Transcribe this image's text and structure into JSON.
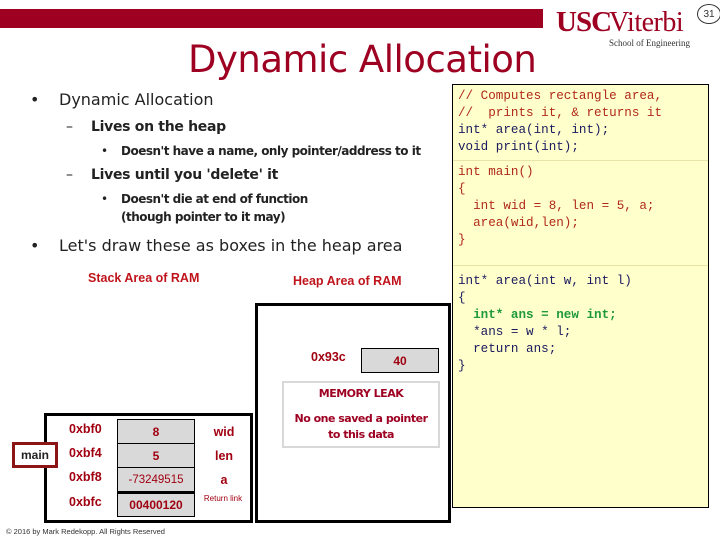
{
  "header": {
    "brand_color": "#9e0022",
    "logo": {
      "usc": "USC",
      "viterbi": "Viterbi",
      "school": "School of Engineering"
    },
    "page_number": "31"
  },
  "slide": {
    "title": "Dynamic Allocation",
    "bullets": [
      {
        "level": 1,
        "marker": "•",
        "text": "Dynamic Allocation"
      },
      {
        "level": 2,
        "marker": "–",
        "text": "Lives on the heap"
      },
      {
        "level": 3,
        "marker": "•",
        "text": "Doesn't have a name, only pointer/address to it"
      },
      {
        "level": 2,
        "marker": "–",
        "text": "Lives until you 'delete' it"
      },
      {
        "level": 3,
        "marker": "•",
        "text": "Doesn't die at end of function"
      },
      {
        "level": 3,
        "marker": "",
        "text": "(though pointer to it may)"
      },
      {
        "level": 1,
        "marker": "•",
        "text": "Let's draw these as boxes in the heap area"
      }
    ]
  },
  "code": {
    "colors": {
      "dark": "#1a1a5e",
      "red": "#b0281a",
      "green": "#1e9a3a"
    },
    "blocks": [
      {
        "lines": [
          {
            "text": "// Computes rectangle area,",
            "color": "red"
          },
          {
            "text": "//  prints it, & returns it",
            "color": "red"
          },
          {
            "text": "int* area(int, int);",
            "color": "dark"
          },
          {
            "text": "void print(int);",
            "color": "dark"
          }
        ]
      },
      {
        "lines": [
          {
            "text": "int main()",
            "color": "red"
          },
          {
            "text": "{",
            "color": "red"
          },
          {
            "text": "  int wid = 8, len = 5, a;",
            "color": "red"
          },
          {
            "text": "  area(wid,len);",
            "color": "red"
          },
          {
            "text": "}",
            "color": "red"
          }
        ]
      },
      {
        "lines": [
          {
            "text": "int* area(int w, int l)",
            "color": "dark"
          },
          {
            "text": "{",
            "color": "dark"
          },
          {
            "text": "  int* ans = new int;",
            "color": "green"
          },
          {
            "text": "  *ans = w * l;",
            "color": "dark"
          },
          {
            "text": "  return ans;",
            "color": "dark"
          },
          {
            "text": "}",
            "color": "dark"
          }
        ]
      }
    ]
  },
  "diagram": {
    "stack_label": "Stack Area of RAM",
    "heap_label": "Heap Area of RAM",
    "heap": {
      "address": "0x93c",
      "value": "40",
      "leak_title": "MEMORY LEAK",
      "leak_desc_line1": "No one saved a pointer",
      "leak_desc_line2": "to this data"
    },
    "frame_label": "main",
    "stack_rows": [
      {
        "address": "0xbf0",
        "value": "8",
        "name": "wid"
      },
      {
        "address": "0xbf4",
        "value": "5",
        "name": "len"
      },
      {
        "address": "0xbf8",
        "value": "-73249515",
        "name": "a"
      },
      {
        "address": "0xbfc",
        "value": "00400120",
        "name": "Return link"
      }
    ]
  },
  "footer": "© 2016 by Mark Redekopp. All Rights Reserved"
}
